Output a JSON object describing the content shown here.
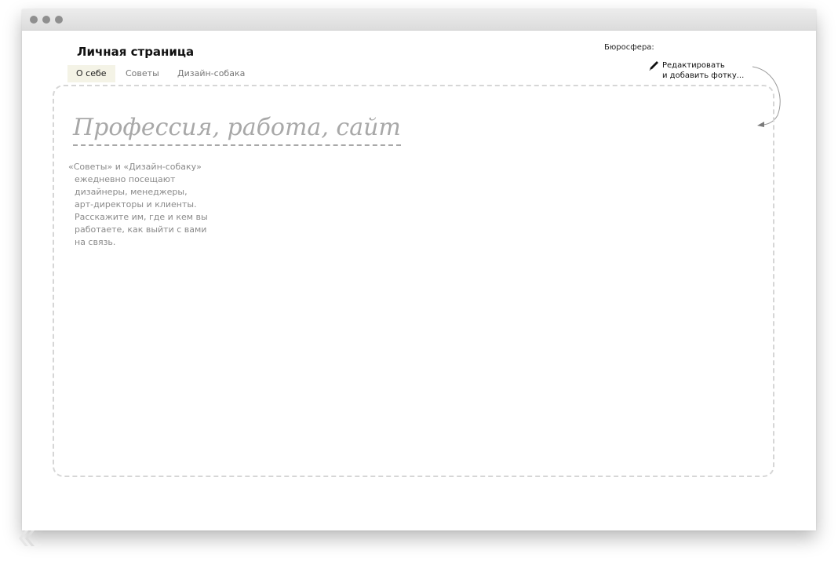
{
  "page": {
    "title": "Личная страница",
    "tabs": [
      {
        "label": "О себе",
        "active": true
      },
      {
        "label": "Советы",
        "active": false
      },
      {
        "label": "Дизайн-собака",
        "active": false
      }
    ]
  },
  "sidebar": {
    "label": "Бюросфера:",
    "edit_line1": "Редактировать",
    "edit_line2": "и добавить фотку..."
  },
  "profile": {
    "profession_placeholder": "Профессия, работа, сайт",
    "hint_lines": [
      "«Советы» и «Дизайн-собаку»",
      "ежедневно посещают",
      "дизайнеры, менеджеры,",
      "арт-директоры и клиенты.",
      "Расскажите им, где и кем вы",
      "работаете, как выйти с вами",
      "на связь."
    ]
  },
  "icons": {
    "pencil": "pencil-icon",
    "arrow": "curved-arrow-icon",
    "window_dots": "window-control-dots"
  },
  "colors": {
    "active_tab_bg": "#f4f3e6",
    "placeholder_text": "#a8a8a8",
    "hint_text": "#8a8a8a",
    "dashed_border": "#d6d6d6"
  }
}
